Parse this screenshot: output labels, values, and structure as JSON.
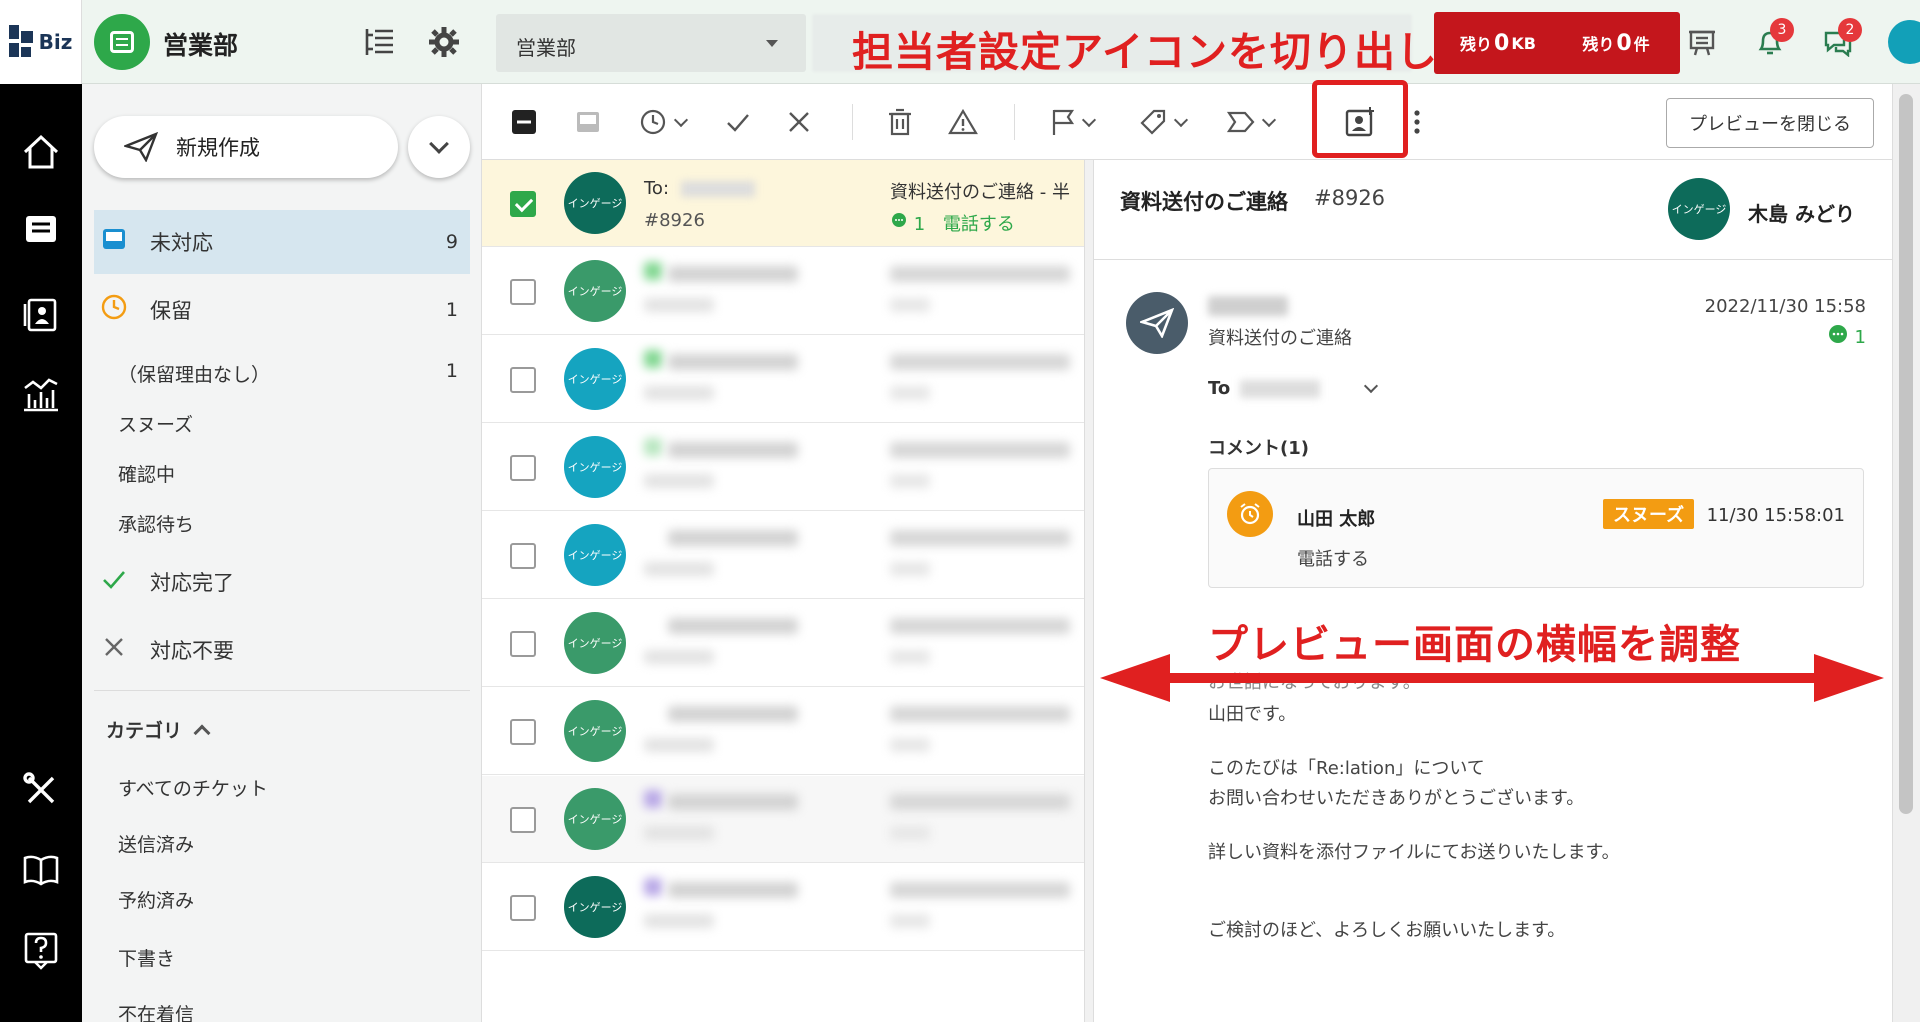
{
  "colors": {
    "accent_green": "#2ea84a",
    "annotation_red": "#e02020",
    "quota_red": "#c4161c",
    "snooze_orange": "#f39c12",
    "selected_row": "#fdf6dc",
    "active_side": "#d6e6ef"
  },
  "topbar": {
    "logo_text": "Biz",
    "group_name": "営業部",
    "dept_select": "営業部",
    "annotation": "担当者設定アイコンを切り出し",
    "quota_kb": {
      "prefix": "残り",
      "value": "0",
      "suffix": "KB"
    },
    "quota_count": {
      "prefix": "残り",
      "value": "0",
      "suffix": "件"
    },
    "notification_count": "3",
    "chat_count": "2",
    "icons": [
      "layout-icon",
      "gear-icon",
      "board-icon",
      "bell-icon",
      "chat-icon"
    ]
  },
  "rail": {
    "icons": [
      "home-icon",
      "inbox-icon",
      "contacts-icon",
      "analytics-icon",
      "tools-icon",
      "book-icon",
      "help-icon"
    ]
  },
  "sidebar": {
    "new_button": "新規作成",
    "items": [
      {
        "label": "未対応",
        "count": "9",
        "icon": "inbox-icon"
      },
      {
        "label": "保留",
        "count": "1",
        "icon": "clock-icon"
      }
    ],
    "hold_sub": [
      {
        "label": "（保留理由なし）",
        "count": "1"
      },
      {
        "label": "スヌーズ",
        "count": ""
      },
      {
        "label": "確認中",
        "count": ""
      },
      {
        "label": "承認待ち",
        "count": ""
      }
    ],
    "done": "対応完了",
    "not_needed": "対応不要",
    "category_header": "カテゴリ",
    "categories": [
      "すべてのチケット",
      "送信済み",
      "予約済み",
      "下書き",
      "不在着信"
    ]
  },
  "toolbar": {
    "close_preview": "プレビューを閉じる"
  },
  "list": {
    "selected": {
      "from_prefix": "To:",
      "number": "#8926",
      "subject": "資料送付のご連絡  - 半",
      "meta_count": "1",
      "meta_text": "電話する",
      "avatar": "インゲージ"
    },
    "avatar_label": "インゲージ",
    "rows": [
      {
        "color": "#3a9a6a",
        "alt": false,
        "dot": "#7ed68e"
      },
      {
        "color": "#15a4c0",
        "alt": false,
        "dot": "#7ed68e"
      },
      {
        "color": "#15a4c0",
        "alt": false,
        "dot": "#b7e6bf"
      },
      {
        "color": "#15a4c0",
        "alt": false,
        "dot": ""
      },
      {
        "color": "#3a9a6a",
        "alt": false,
        "dot": ""
      },
      {
        "color": "#3a9a6a",
        "alt": false,
        "dot": ""
      },
      {
        "color": "#3a9a6a",
        "alt": true,
        "dot": "#b7a6e6"
      },
      {
        "color": "#0d6b5a",
        "alt": false,
        "dot": "#b7a6e6"
      }
    ]
  },
  "preview": {
    "title": "資料送付のご連絡",
    "ticket": "#8926",
    "assignee_avatar": "インゲージ",
    "assignee": "木島 みどり",
    "message": {
      "subject": "資料送付のご連絡",
      "date": "2022/11/30 15:58",
      "comment_count": "1",
      "to_label": "To"
    },
    "comment_header": "コメント(1)",
    "comment": {
      "name": "山田 太郎",
      "tag": "スヌーズ",
      "time": "11/30 15:58:01",
      "text": "電話する"
    },
    "body": [
      "お世話になっております。",
      "山田です。",
      "このたびは「Re:lation」について",
      "お問い合わせいただきありがとうございます。",
      "詳しい資料を添付ファイルにてお送りいたします。",
      "ご検討のほど、よろしくお願いいたします。"
    ],
    "annotation": "プレビュー画面の横幅を調整"
  }
}
